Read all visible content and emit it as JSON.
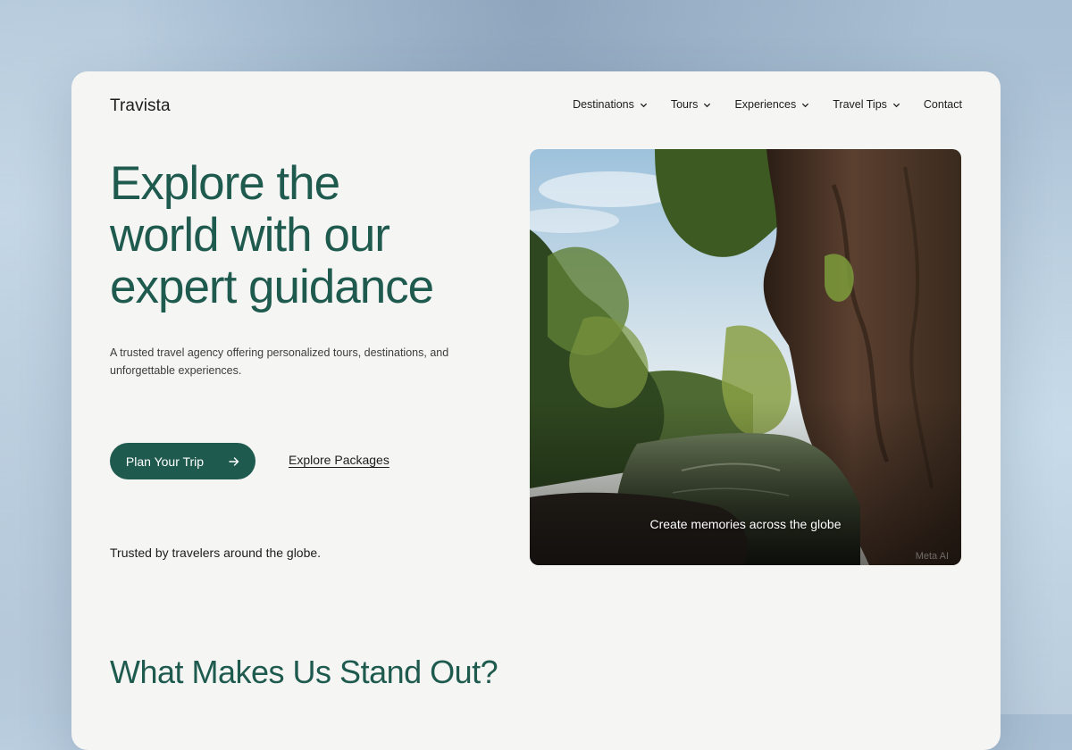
{
  "brand": {
    "name": "Travista"
  },
  "nav": {
    "items": [
      {
        "label": "Destinations",
        "has_dropdown": true
      },
      {
        "label": "Tours",
        "has_dropdown": true
      },
      {
        "label": "Experiences",
        "has_dropdown": true
      },
      {
        "label": "Travel Tips",
        "has_dropdown": true
      },
      {
        "label": "Contact",
        "has_dropdown": false
      }
    ]
  },
  "hero": {
    "headline_lines": [
      "Explore the",
      "world with our",
      "expert guidance"
    ],
    "subtitle": "A trusted travel agency offering personalized tours, destinations, and unforgettable experiences.",
    "primary_button": "Plan Your Trip",
    "primary_button_icon": "arrow-right-icon",
    "secondary_link": "Explore Packages",
    "trusted_text": "Trusted by travelers around the globe.",
    "image": {
      "caption": "Create memories across the globe",
      "watermark": "Meta AI"
    }
  },
  "section": {
    "title": "What Makes Us Stand Out?"
  },
  "colors": {
    "accent": "#1f5a4e",
    "card_background": "#f5f5f4",
    "text": "#1d1d1d"
  }
}
